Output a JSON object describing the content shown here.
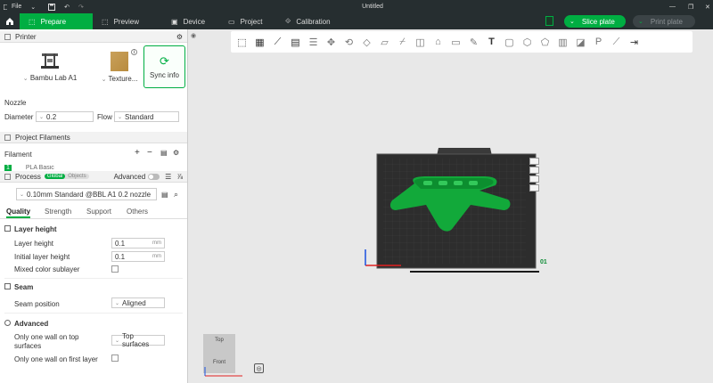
{
  "titlebar": {
    "menu_label": "File",
    "title": "Untitled"
  },
  "tabs": [
    {
      "label": "Prepare",
      "icon": "prepare-icon"
    },
    {
      "label": "Preview",
      "icon": "preview-icon"
    },
    {
      "label": "Device",
      "icon": "device-icon"
    },
    {
      "label": "Project",
      "icon": "project-icon"
    },
    {
      "label": "Calibration",
      "icon": "calibration-icon"
    }
  ],
  "actions": {
    "slice": "Slice plate",
    "print": "Print plate"
  },
  "printer": {
    "section_title": "Printer",
    "name": "Bambu Lab A1",
    "plate": "Texture...",
    "sync": "Sync info",
    "nozzle_label": "Nozzle",
    "diameter_label": "Diameter",
    "diameter_value": "0.2",
    "flow_label": "Flow",
    "flow_value": "Standard"
  },
  "filaments": {
    "section_title": "Project Filaments",
    "placeholder": "Filament",
    "first_index": "1",
    "first_name": "PLA Basic"
  },
  "process": {
    "section_title": "Process",
    "toggle_global": "Global",
    "toggle_objects": "Objects",
    "advanced_label": "Advanced",
    "preset": "0.10mm Standard @BBL A1 0.2 nozzle",
    "tabs": [
      "Quality",
      "Strength",
      "Support",
      "Others"
    ],
    "groups": {
      "layer_height": "Layer height",
      "seam": "Seam",
      "advanced": "Advanced"
    },
    "layer_height_label": "Layer height",
    "layer_height_value": "0.1",
    "initial_layer_label": "Initial layer height",
    "initial_layer_value": "0.1",
    "unit": "mm",
    "mixed_color_label": "Mixed color sublayer",
    "seam_position_label": "Seam position",
    "seam_position_value": "Aligned",
    "one_wall_top_label": "Only one wall on top surfaces",
    "one_wall_top_value": "Top surfaces",
    "one_wall_first_label": "Only one wall on first layer"
  },
  "viewport": {
    "plate_number": "01",
    "cube_top": "Top",
    "cube_front": "Front"
  },
  "colors": {
    "accent": "#00ae42",
    "titlebar": "#262e30"
  }
}
